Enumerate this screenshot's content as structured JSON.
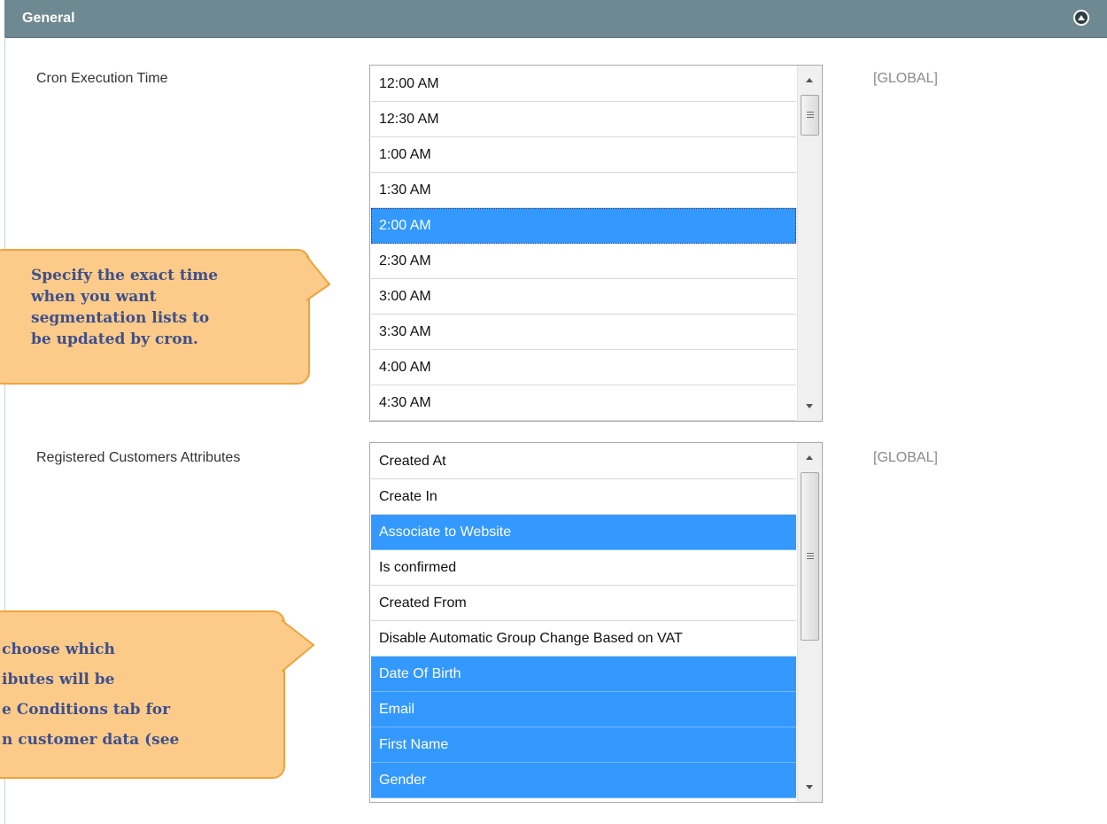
{
  "section": {
    "title": "General"
  },
  "cron": {
    "label": "Cron Execution Time",
    "scope": "[GLOBAL]",
    "options": [
      "12:00 AM",
      "12:30 AM",
      "1:00 AM",
      "1:30 AM",
      "2:00 AM",
      "2:30 AM",
      "3:00 AM",
      "3:30 AM",
      "4:00 AM",
      "4:30 AM"
    ],
    "selected": "2:00 AM"
  },
  "attributes": {
    "label": "Registered Customers Attributes",
    "scope": "[GLOBAL]",
    "options": [
      "Created At",
      "Create In",
      "Associate to Website",
      "Is confirmed",
      "Created From",
      "Disable Automatic Group Change Based on VAT",
      "Date Of Birth",
      "Email",
      "First Name",
      "Gender"
    ],
    "selected": [
      "Associate to Website",
      "Date Of Birth",
      "Email",
      "First Name",
      "Gender"
    ]
  },
  "callouts": {
    "cron_tip": "Specify the exact time\nwhen you want\nsegmentation lists to\nbe updated by cron.",
    "attributes_tip": "choose which\nibutes will be\ne Conditions tab for\nn customer data (see"
  },
  "colors": {
    "header_bg": "#6f8992",
    "selection": "#3399ff",
    "callout_bg": "#fccb8a",
    "callout_border": "#f0a23c",
    "callout_text": "#3f4f8a"
  },
  "icons": {
    "collapse": "chevron-up-circle-icon"
  }
}
